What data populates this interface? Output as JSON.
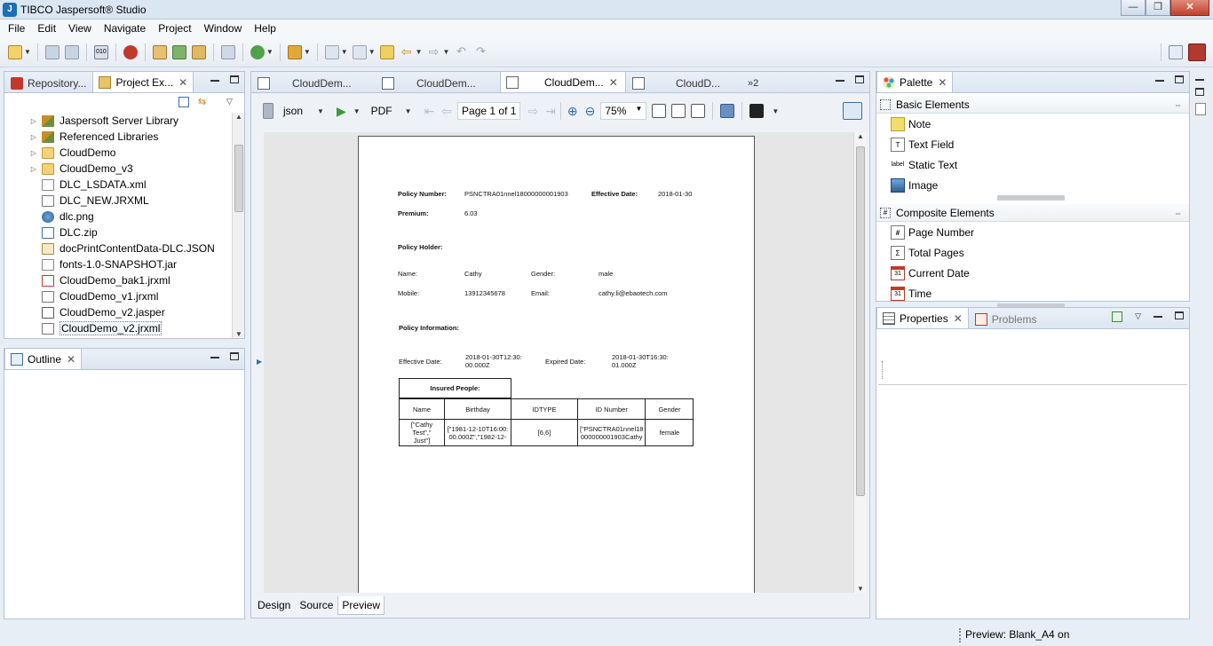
{
  "window": {
    "title": "TIBCO Jaspersoft® Studio",
    "controls": [
      "minimize",
      "maximize",
      "close"
    ]
  },
  "menu": [
    "File",
    "Edit",
    "View",
    "Navigate",
    "Project",
    "Window",
    "Help"
  ],
  "left_panel": {
    "tabs": [
      {
        "label": "Repository...",
        "active": false
      },
      {
        "label": "Project Ex...",
        "active": true
      }
    ],
    "tree": [
      {
        "label": "Jaspersoft Server Library",
        "expandable": true,
        "icon": "library-icon"
      },
      {
        "label": "Referenced Libraries",
        "expandable": true,
        "icon": "library-icon"
      },
      {
        "label": "CloudDemo",
        "expandable": true,
        "icon": "folder-icon"
      },
      {
        "label": "CloudDemo_v3",
        "expandable": true,
        "icon": "folder-icon"
      },
      {
        "label": "DLC_LSDATA.xml",
        "expandable": false,
        "icon": "xml-file-icon"
      },
      {
        "label": "DLC_NEW.JRXML",
        "expandable": false,
        "icon": "jrxml-file-icon"
      },
      {
        "label": "dlc.png",
        "expandable": false,
        "icon": "image-file-icon"
      },
      {
        "label": "DLC.zip",
        "expandable": false,
        "icon": "zip-file-icon"
      },
      {
        "label": "docPrintContentData-DLC.JSON",
        "expandable": false,
        "icon": "json-file-icon"
      },
      {
        "label": "fonts-1.0-SNAPSHOT.jar",
        "expandable": false,
        "icon": "jar-file-icon"
      },
      {
        "label": "CloudDemo_bak1.jrxml",
        "expandable": false,
        "icon": "jrxml-error-icon"
      },
      {
        "label": "CloudDemo_v1.jrxml",
        "expandable": false,
        "icon": "jrxml-file-icon"
      },
      {
        "label": "CloudDemo_v2.jasper",
        "expandable": false,
        "icon": "jasper-file-icon"
      },
      {
        "label": "CloudDemo_v2.jrxml",
        "expandable": false,
        "icon": "jrxml-file-icon",
        "selected": true
      }
    ]
  },
  "outline": {
    "tab": "Outline"
  },
  "editor": {
    "tabs": [
      {
        "label": "CloudDem...",
        "active": false
      },
      {
        "label": "CloudDem...",
        "active": false
      },
      {
        "label": "CloudDem...",
        "active": true
      },
      {
        "label": "CloudD...",
        "active": false
      }
    ],
    "overflow": "»2",
    "toolbar": {
      "datasource": "json",
      "format": "PDF",
      "page_indicator": "Page 1 of 1",
      "zoom": "75%"
    },
    "bottom_tabs": [
      {
        "label": "Design",
        "active": false
      },
      {
        "label": "Source",
        "active": false
      },
      {
        "label": "Preview",
        "active": true
      }
    ],
    "report": {
      "policy_number_label": "Policy Number:",
      "policy_number_value": "PSNCTRA01nnel18000000001903",
      "effective_date_label": "Effective Date:",
      "effective_date_value": "2018-01-30",
      "premium_label": "Premium:",
      "premium_value": "6.03",
      "policy_holder_heading": "Policy Holder:",
      "name_label": "Name:",
      "name_value": "Cathy",
      "gender_label": "Gender:",
      "gender_value": "male",
      "mobile_label": "Mobile:",
      "mobile_value": "13912345678",
      "email_label": "Email:",
      "email_value": "cathy.li@ebaotech.com",
      "policy_info_heading": "Policy Information:",
      "eff_date_label": "Effective Date:",
      "eff_date_value_1": "2018-01-30T12:30:",
      "eff_date_value_2": "00.000Z",
      "exp_date_label": "Expired Date:",
      "exp_date_value_1": "2018-01-30T16:30:",
      "exp_date_value_2": "01.000Z",
      "insured_heading": "Insured People:",
      "columns": [
        "Name",
        "Birthday",
        "IDTYPE",
        "ID Number",
        "Gender"
      ],
      "row": {
        "name_1": "[\"Cathy Test\",\"",
        "name_2": "Just\"]",
        "birthday_1": "[\"1981-12-10T16:00:",
        "birthday_2": "00.000Z\",\"1982-12-",
        "idtype": "[6,6]",
        "idnumber_1": "[\"PSNCTRA01nnel18",
        "idnumber_2": "000000001903Cathy",
        "gender": "female"
      }
    }
  },
  "palette": {
    "tab": "Palette",
    "sections": [
      {
        "title": "Basic Elements",
        "items": [
          {
            "label": "Note",
            "icon": "note-icon"
          },
          {
            "label": "Text Field",
            "icon": "text-field-icon"
          },
          {
            "label": "Static Text",
            "icon": "static-text-icon"
          },
          {
            "label": "Image",
            "icon": "image-icon"
          }
        ]
      },
      {
        "title": "Composite Elements",
        "items": [
          {
            "label": "Page Number",
            "icon": "page-number-icon"
          },
          {
            "label": "Total Pages",
            "icon": "total-pages-icon"
          },
          {
            "label": "Current Date",
            "icon": "calendar-icon"
          },
          {
            "label": "Time",
            "icon": "calendar-icon"
          }
        ]
      }
    ]
  },
  "properties": {
    "tabs": [
      {
        "label": "Properties",
        "active": true
      },
      {
        "label": "Problems",
        "active": false
      }
    ]
  },
  "status": {
    "text": "Preview: Blank_A4 on"
  },
  "colors": {
    "accent": "#1b6fb8",
    "chrome": "#dde6f1",
    "close_red": "#c2402a"
  }
}
